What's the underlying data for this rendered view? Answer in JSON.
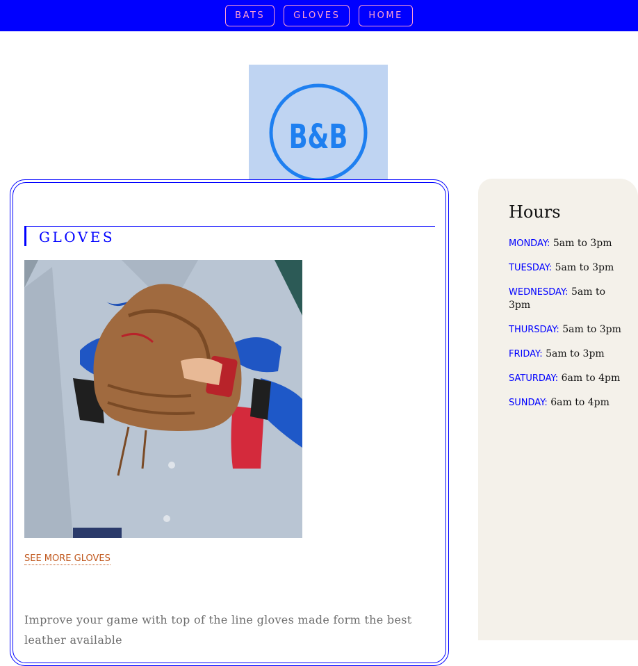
{
  "nav": {
    "items": [
      {
        "label": "BATS"
      },
      {
        "label": "GLOVES"
      },
      {
        "label": "HOME"
      }
    ],
    "background": "#0000ff",
    "link_color": "#ff9fd0"
  },
  "logo": {
    "text": "B&B",
    "background": "#bfd4f2",
    "ring_color": "#1e7ff0"
  },
  "main": {
    "heading": "GLOVES",
    "image_icon": "baseball-glove-photo",
    "see_more_label": "SEE MORE GLOVES",
    "description": "Improve your game with top of the line gloves made form the best leather available"
  },
  "hours": {
    "title": "Hours",
    "items": [
      {
        "day": "MONDAY:",
        "time": "5am to 3pm"
      },
      {
        "day": "TUESDAY:",
        "time": "5am to 3pm"
      },
      {
        "day": "WEDNESDAY:",
        "time": "5am to 3pm"
      },
      {
        "day": "THURSDAY:",
        "time": "5am to 3pm"
      },
      {
        "day": "FRIDAY:",
        "time": "5am to 3pm"
      },
      {
        "day": "SATURDAY:",
        "time": "6am to 4pm"
      },
      {
        "day": "SUNDAY:",
        "time": "6am to 4pm"
      }
    ]
  },
  "colors": {
    "accent": "#0000ff",
    "link_orange": "#c0561b",
    "panel_bg": "#f4f1ea"
  }
}
